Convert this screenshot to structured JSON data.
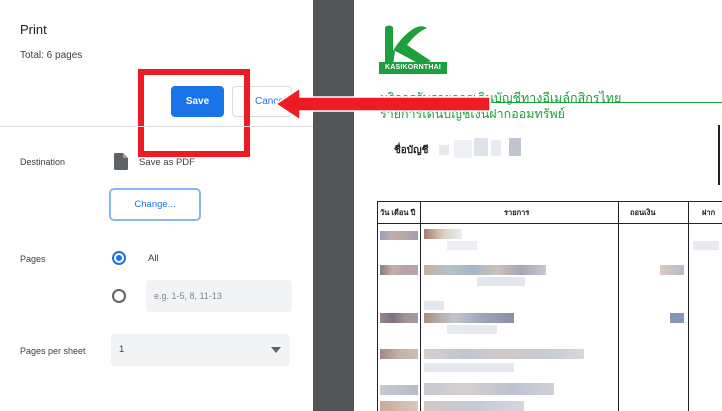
{
  "print_panel": {
    "title": "Print",
    "total": "Total: 6 pages",
    "save_label": "Save",
    "cancel_label": "Cancel",
    "destination": {
      "label": "Destination",
      "value": "Save as PDF",
      "change_label": "Change..."
    },
    "pages": {
      "label": "Pages",
      "all_label": "All",
      "custom_placeholder": "e.g. 1-5, 8, 11-13"
    },
    "pages_per_sheet": {
      "label": "Pages per sheet",
      "value": "1"
    }
  },
  "preview": {
    "logo_text": "KASIKORNTHAI",
    "title_line1": "บริการรับรายการเดินบัญชีทางอีเมล์กสิกรไทย",
    "title_line2": "รายการเดินบัญชีเงินฝากออมทรัพย์",
    "account_label": "ชื่อบัญชี",
    "table_headers": [
      "วัน เดือน ปี",
      "รายการ",
      "ถอนเงิน",
      "ฝาก"
    ]
  },
  "colors": {
    "accent": "#1a73e8",
    "annotation_red": "#ee1b24",
    "brand_green": "#1e9f3d"
  }
}
